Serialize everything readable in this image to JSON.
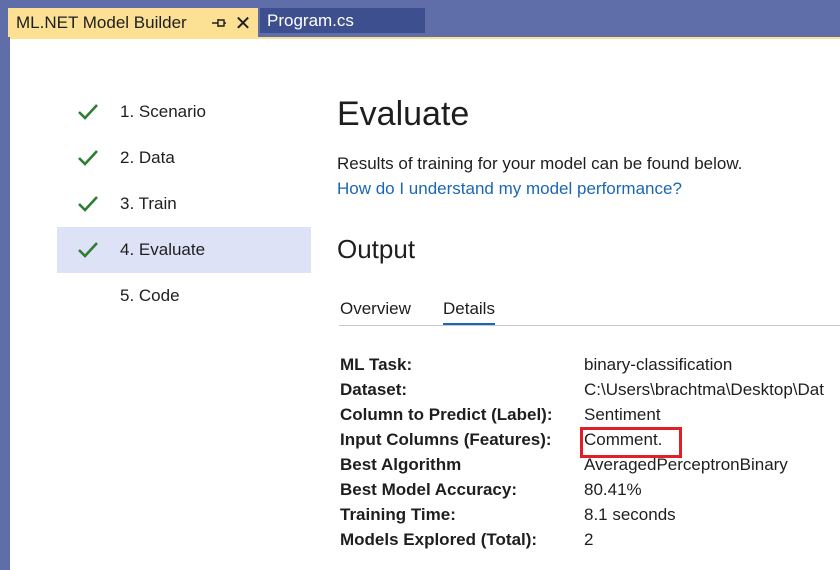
{
  "tabs": {
    "active": {
      "title": "ML.NET Model Builder",
      "pin_glyph": "⊣",
      "close_glyph": "✕"
    },
    "inactive": {
      "title": "Program.cs"
    }
  },
  "steps": [
    {
      "label": "1. Scenario",
      "done": true
    },
    {
      "label": "2. Data",
      "done": true
    },
    {
      "label": "3. Train",
      "done": true
    },
    {
      "label": "4. Evaluate",
      "done": true,
      "active": true
    },
    {
      "label": "5. Code",
      "done": false
    }
  ],
  "main": {
    "title": "Evaluate",
    "description": "Results of training for your model can be found below.",
    "help_link": "How do I understand my model performance?",
    "output_title": "Output",
    "output_tabs": [
      "Overview",
      "Details"
    ],
    "selected_tab": "Details"
  },
  "details": [
    {
      "key": "ML Task:",
      "value": "binary-classification"
    },
    {
      "key": "Dataset:",
      "value": "C:\\Users\\brachtma\\Desktop\\Dat"
    },
    {
      "key": "Column to Predict (Label):",
      "value": "Sentiment"
    },
    {
      "key": "Input Columns (Features):",
      "value": "Comment."
    },
    {
      "key": "Best Algorithm",
      "value": "AveragedPerceptronBinary"
    },
    {
      "key": "Best Model Accuracy:",
      "value": "80.41%"
    },
    {
      "key": "Training Time:",
      "value": "8.1 seconds"
    },
    {
      "key": "Models Explored (Total):",
      "value": "2"
    }
  ],
  "colors": {
    "frame": "#5f6ea8",
    "active_tab": "#fce093",
    "check": "#2e7d32",
    "link": "#1a67b5",
    "highlight": "#e21f26",
    "active_step_bg": "#dde2f7"
  }
}
